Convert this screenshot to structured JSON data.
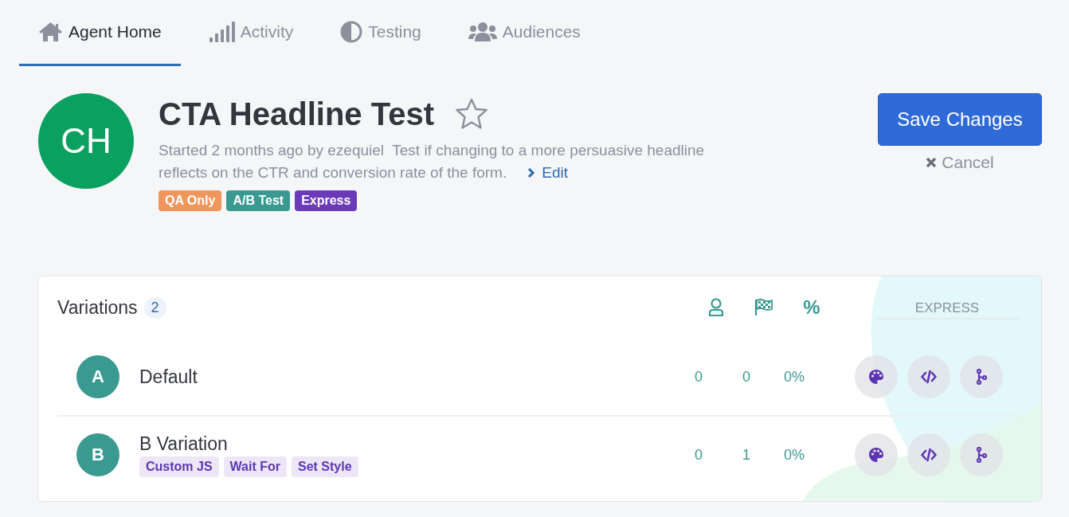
{
  "tabs": [
    {
      "label": "Agent Home",
      "selected": true
    },
    {
      "label": "Activity",
      "selected": false
    },
    {
      "label": "Testing",
      "selected": false
    },
    {
      "label": "Audiences",
      "selected": false
    }
  ],
  "agent": {
    "initials": "CH",
    "title": "CTA Headline Test",
    "starred": false,
    "meta": "Started 2 months ago by ezequiel",
    "description": "Test if changing to a more persuasive headline reflects on the CTR and conversion rate of the form.",
    "edit": "Edit",
    "tags": [
      {
        "label": "QA Only",
        "color": "#ef965c"
      },
      {
        "label": "A/B Test",
        "color": "#3a9990"
      },
      {
        "label": "Express",
        "color": "#6a3ab8"
      }
    ]
  },
  "actions": {
    "save": "Save Changes",
    "cancel": "Cancel"
  },
  "variations": {
    "title": "Variations",
    "count": "2",
    "columns": [
      {
        "kind": "icon"
      },
      {
        "kind": "icon"
      },
      {
        "kind": "text",
        "label": "%"
      }
    ],
    "express_label": "EXPRESS",
    "rows": [
      {
        "letter": "A",
        "name": "Default",
        "tags": [],
        "values": [
          "0",
          "0",
          "0%"
        ]
      },
      {
        "letter": "B",
        "name": "B Variation",
        "tags": [
          "Custom JS",
          "Wait For",
          "Set Style"
        ],
        "values": [
          "0",
          "1",
          "0%"
        ]
      }
    ]
  }
}
